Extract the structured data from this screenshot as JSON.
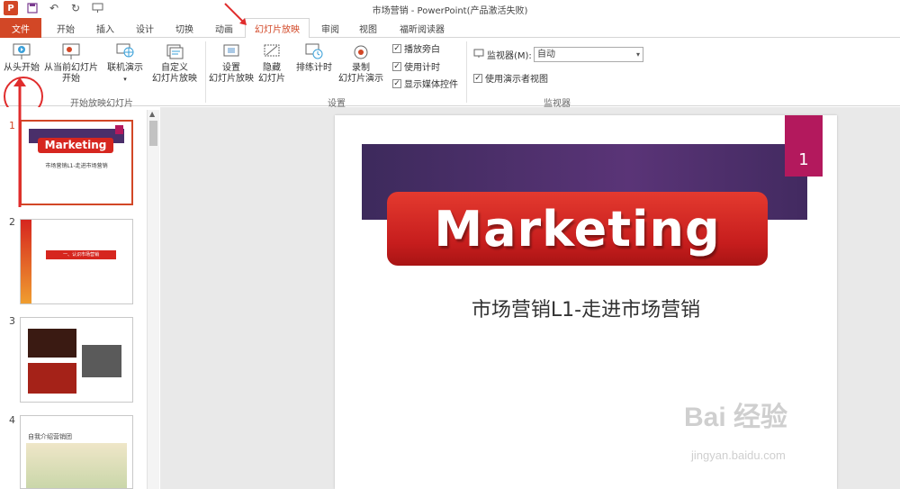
{
  "window": {
    "title": "市场营销 - PowerPoint(产品激活失败)"
  },
  "qat": {
    "app_icon": "P",
    "save_icon": "save-icon",
    "undo_icon": "undo-icon",
    "redo_icon": "redo-icon",
    "present_icon": "present-icon"
  },
  "tabs": [
    "文件",
    "开始",
    "插入",
    "设计",
    "切换",
    "动画",
    "幻灯片放映",
    "审阅",
    "视图",
    "福昕阅读器"
  ],
  "ribbon": {
    "from_beginning": "从头开始",
    "from_current_l1": "从当前幻灯片",
    "from_current_l2": "开始",
    "online_present": "联机演示",
    "custom_l1": "自定义",
    "custom_l2": "幻灯片放映",
    "group_start": "开始放映幻灯片",
    "setup_l1": "设置",
    "setup_l2": "幻灯片放映",
    "hide_l1": "隐藏",
    "hide_l2": "幻灯片",
    "rehearse": "排练计时",
    "record_l1": "录制",
    "record_l2": "幻灯片演示",
    "play_narration": "播放旁白",
    "use_timings": "使用计时",
    "show_media": "显示媒体控件",
    "group_setup": "设置",
    "monitor_label": "监视器(M):",
    "monitor_value": "自动",
    "presenter_view": "使用演示者视图",
    "group_monitors": "监视器"
  },
  "thumbnails": [
    {
      "num": "1",
      "title": "Marketing",
      "subtitle": "市场营销L1-走进市场营销"
    },
    {
      "num": "2",
      "label": "一、认识市场营销"
    },
    {
      "num": "3"
    },
    {
      "num": "4",
      "label": "自我介绍营销团"
    }
  ],
  "slide": {
    "number": "1",
    "title": "Marketing",
    "subtitle": "市场营销L1-走进市场营销"
  },
  "watermark": {
    "text": "Bai 经验",
    "sub": "jingyan.baidu.com"
  },
  "colors": {
    "accent": "#d24726",
    "banner": "#4a2f6a",
    "title_red": "#d6261f",
    "badge": "#b3195d"
  }
}
